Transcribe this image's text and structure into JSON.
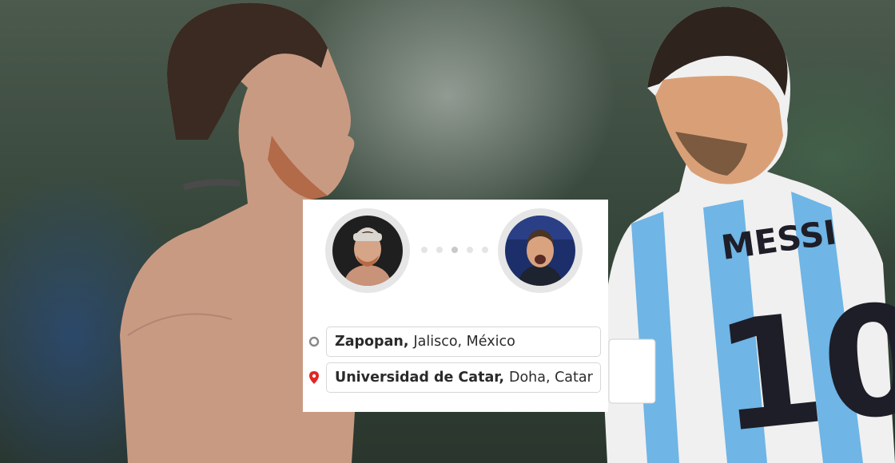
{
  "route": {
    "origin": {
      "name": "Zapopan,",
      "rest": "Jalisco, México"
    },
    "destination": {
      "name": "Universidad de Catar,",
      "rest": "Doha, Catar"
    }
  },
  "progress": {
    "total_steps": 5,
    "active_step": 3
  },
  "colors": {
    "origin_marker": "#888888",
    "destination_marker": "#e02626",
    "jersey_blue": "#6fb5e6",
    "card_bg": "#ffffff"
  },
  "icons": {
    "origin": "circle-outline-icon",
    "destination": "map-pin-icon"
  }
}
